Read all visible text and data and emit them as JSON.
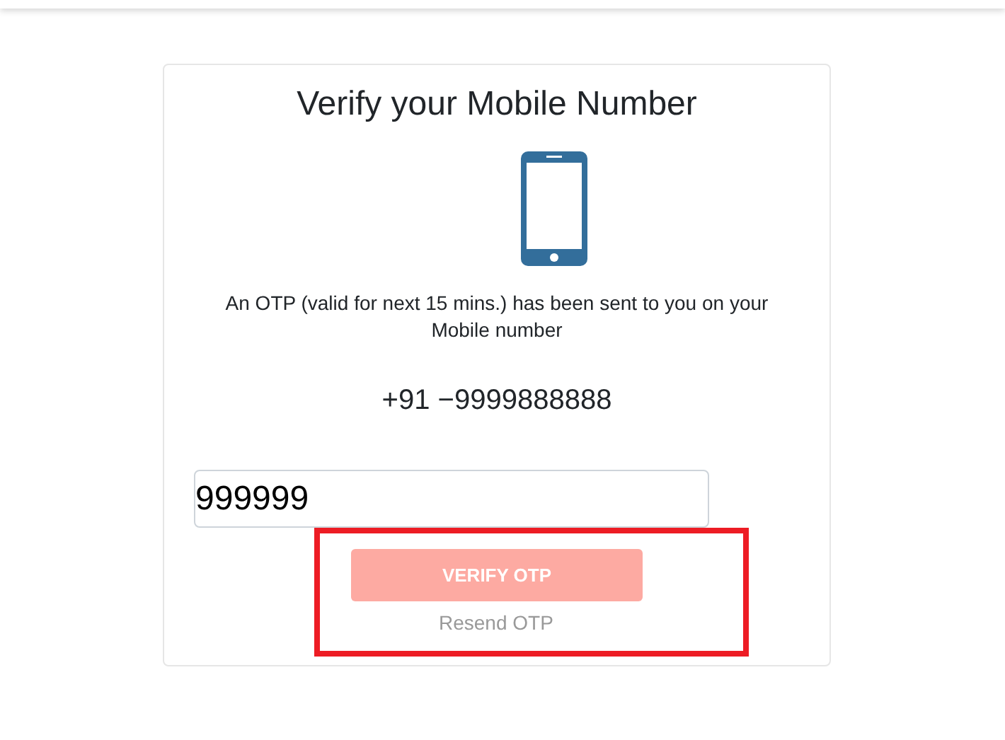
{
  "title": "Verify your Mobile Number",
  "message": "An OTP (valid for next 15 mins.) has been sent to you on your Mobile number",
  "phone_number": "+91 −9999888888",
  "otp_field": {
    "value": "999999"
  },
  "verify_button": {
    "label": "VERIFY OTP",
    "disabled": true
  },
  "resend_link": {
    "label": "Resend OTP",
    "disabled": true
  },
  "highlight": {
    "on": true
  }
}
